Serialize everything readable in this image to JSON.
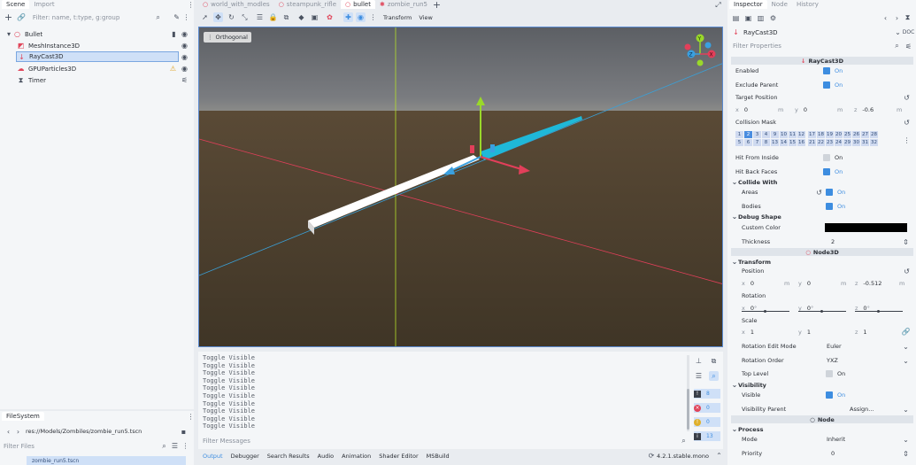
{
  "left": {
    "tabs": [
      "Scene",
      "Import"
    ],
    "filter_placeholder": "Filter: name, t:type, g:group",
    "tree": [
      "Bullet",
      "MeshInstance3D",
      "RayCast3D",
      "GPUParticles3D",
      "Timer"
    ]
  },
  "filesystem": {
    "title": "FileSystem",
    "path": "res://Models/Zombiles/zombie_run5.tscn",
    "filter_placeholder": "Filter Files",
    "file_item": "zombie_run5.tscn"
  },
  "editor_tabs": [
    "world_with_modles",
    "steampunk_rifle",
    "bullet",
    "zombie_run5"
  ],
  "toolbar": {
    "transform": "Transform",
    "view": "View"
  },
  "viewport": {
    "label": "Orthogonal",
    "gizmo_axes": [
      "Y",
      "X",
      "Z"
    ]
  },
  "console": {
    "lines": [
      "Toggle Visible",
      "Toggle Visible",
      "Toggle Visible",
      "Toggle Visible",
      "Toggle Visible",
      "Toggle Visible",
      "Toggle Visible",
      "Toggle Visible",
      "Toggle Visible",
      "Toggle Visible"
    ],
    "filter_placeholder": "Filter Messages",
    "counts": [
      "8",
      "0",
      "0",
      "13"
    ]
  },
  "bottom_tabs": [
    "Output",
    "Debugger",
    "Search Results",
    "Audio",
    "Animation",
    "Shader Editor",
    "MSBuild"
  ],
  "version": "4.2.1.stable.mono",
  "inspector": {
    "tabs": [
      "Inspector",
      "Node",
      "History"
    ],
    "node_name": "RayCast3D",
    "filter_placeholder": "Filter Properties",
    "section_raycast": "RayCast3D",
    "enabled": {
      "label": "Enabled",
      "value": "On"
    },
    "exclude_parent": {
      "label": "Exclude Parent",
      "value": "On"
    },
    "target_position": {
      "label": "Target Position",
      "x": "0",
      "y": "0",
      "z": "-0.6",
      "unit": "m"
    },
    "collision_mask": {
      "label": "Collision Mask",
      "row1": [
        "1",
        "2",
        "3",
        "4",
        "9",
        "10",
        "11",
        "12",
        "17",
        "18",
        "19",
        "20",
        "25",
        "26",
        "27",
        "28"
      ],
      "row2": [
        "5",
        "6",
        "7",
        "8",
        "13",
        "14",
        "15",
        "16",
        "21",
        "22",
        "23",
        "24",
        "29",
        "30",
        "31",
        "32"
      ]
    },
    "hit_from_inside": {
      "label": "Hit From Inside",
      "value": "On"
    },
    "hit_back_faces": {
      "label": "Hit Back Faces",
      "value": "On"
    },
    "collide_with": "Collide With",
    "areas": {
      "label": "Areas",
      "value": "On"
    },
    "bodies": {
      "label": "Bodies",
      "value": "On"
    },
    "debug_shape": "Debug Shape",
    "custom_color": {
      "label": "Custom Color",
      "color": "#000000"
    },
    "thickness": {
      "label": "Thickness",
      "value": "2"
    },
    "section_node3d": "Node3D",
    "transform": "Transform",
    "position": {
      "label": "Position",
      "x": "0",
      "y": "0",
      "z": "-0.512",
      "unit": "m"
    },
    "rotation": {
      "label": "Rotation",
      "x": "0",
      "y": "0",
      "z": "0",
      "unit": "°"
    },
    "scale": {
      "label": "Scale",
      "x": "1",
      "y": "1",
      "z": "1"
    },
    "rotation_edit_mode": {
      "label": "Rotation Edit Mode",
      "value": "Euler"
    },
    "rotation_order": {
      "label": "Rotation Order",
      "value": "YXZ"
    },
    "top_level": {
      "label": "Top Level",
      "value": "On"
    },
    "visibility": "Visibility",
    "visible": {
      "label": "Visible",
      "value": "On"
    },
    "visibility_parent": {
      "label": "Visibility Parent",
      "value": "Assign..."
    },
    "section_node": "Node",
    "process": "Process",
    "mode": {
      "label": "Mode",
      "value": "Inherit"
    },
    "priority": {
      "label": "Priority",
      "value": "0"
    }
  },
  "colors": {
    "accent": "#3d8de0",
    "viewport_sky": "#63666c",
    "viewport_ground": "#4a3e2e",
    "ray": "#1fb8d8",
    "y_axis": "#9ad82a",
    "x_axis": "#e23f5a",
    "z_axis": "#3aa0e0"
  }
}
